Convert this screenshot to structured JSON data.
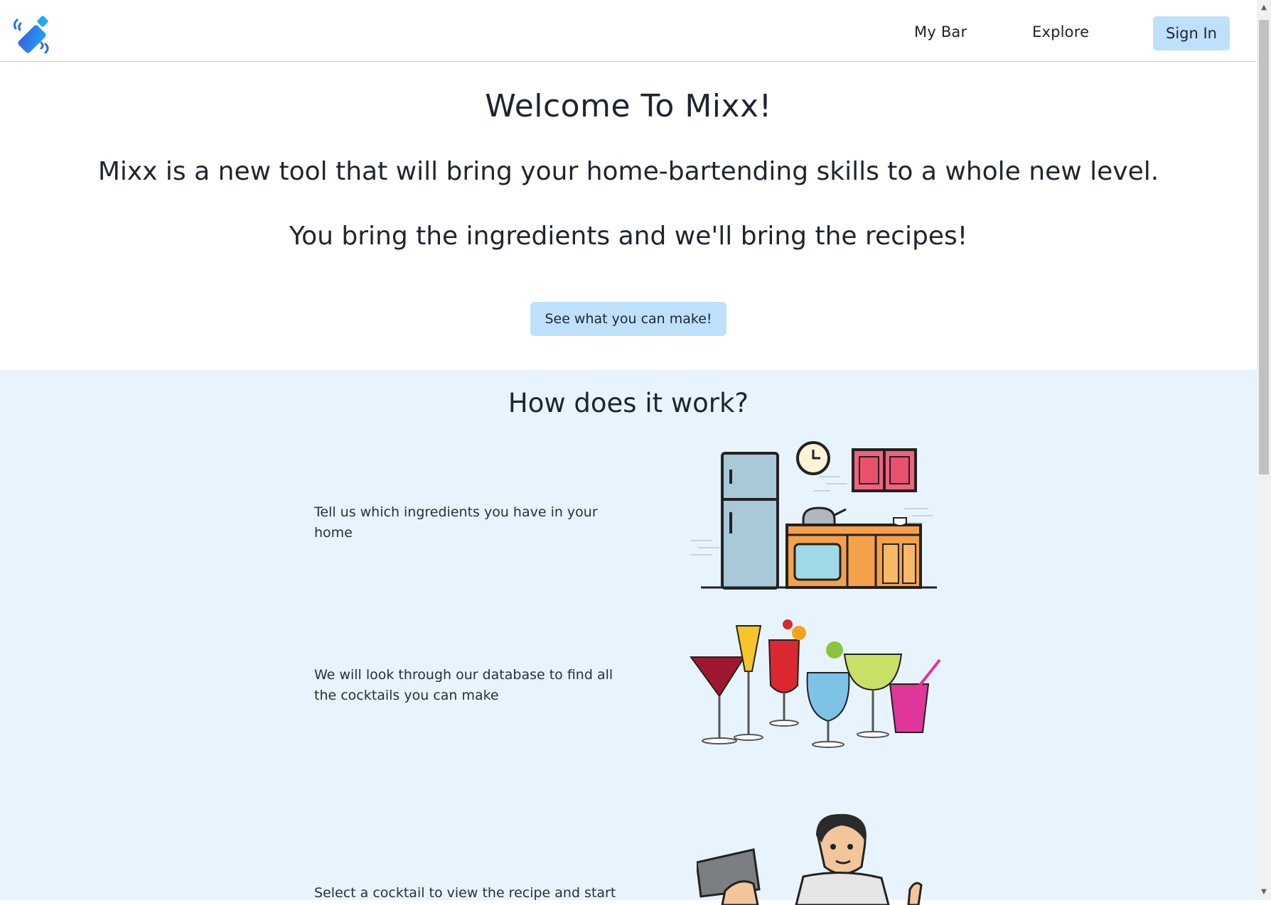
{
  "nav": {
    "my_bar": "My Bar",
    "explore": "Explore",
    "sign_in": "Sign In"
  },
  "hero": {
    "title": "Welcome To Mixx!",
    "tagline": "Mixx is a new tool that will bring your home-bartending skills to a whole new level.",
    "subtitle": "You bring the ingredients and we'll bring the recipes!",
    "cta_label": "See what you can make!"
  },
  "how_it_works": {
    "title": "How does it work?",
    "steps": [
      {
        "text": "Tell us which ingredients you have in your home",
        "image": "kitchen-illustration"
      },
      {
        "text": "We will look through our database to find all the cocktails you can make",
        "image": "cocktails-illustration"
      },
      {
        "text": "Select a cocktail to view the recipe and start",
        "image": "bartender-illustration"
      }
    ]
  },
  "colors": {
    "button_bg": "#bfe0fb",
    "section_bg": "#e8f4fd",
    "logo_blue": "#2f6ce5"
  }
}
